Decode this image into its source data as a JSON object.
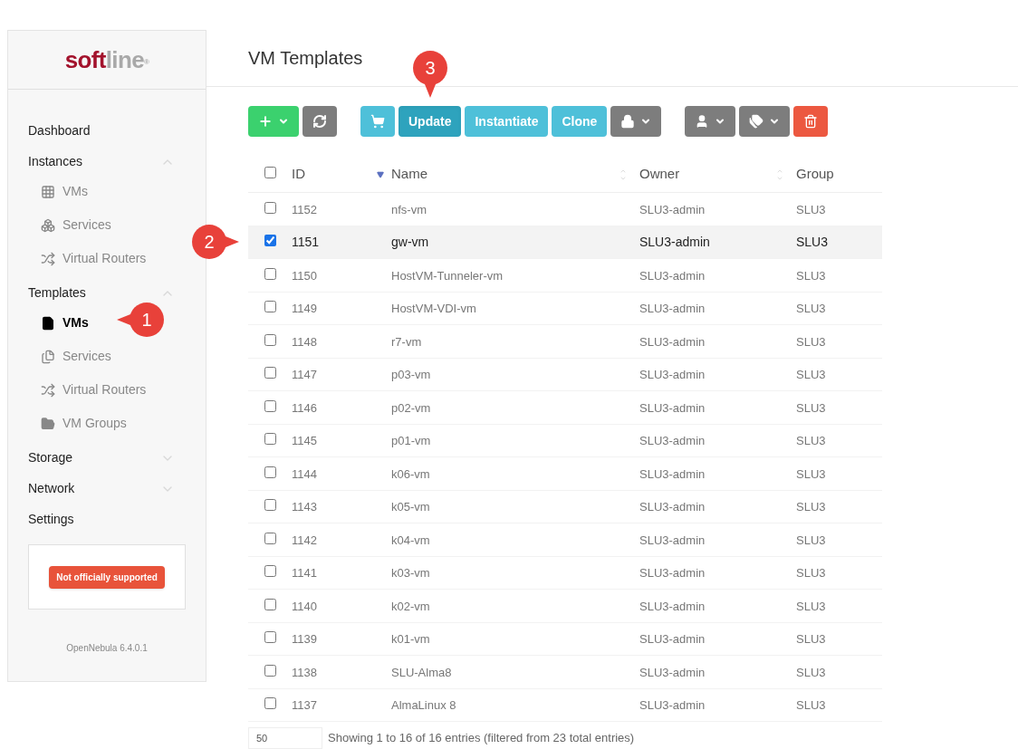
{
  "logo": {
    "part1": "soft",
    "part2": "line",
    "mark": "®"
  },
  "sidebar": {
    "items": [
      {
        "label": "Dashboard",
        "kind": "link"
      },
      {
        "label": "Instances",
        "kind": "group",
        "expanded": true,
        "children": [
          {
            "label": "VMs",
            "kind": "vms",
            "selected": false
          },
          {
            "label": "Services",
            "kind": "services",
            "selected": false
          },
          {
            "label": "Virtual Routers",
            "kind": "routers",
            "selected": false
          }
        ]
      },
      {
        "label": "Templates",
        "kind": "group",
        "expanded": true,
        "children": [
          {
            "label": "VMs",
            "kind": "templates",
            "selected": true
          },
          {
            "label": "Services",
            "kind": "service-templates",
            "selected": false
          },
          {
            "label": "Virtual Routers",
            "kind": "routers",
            "selected": false
          },
          {
            "label": "VM Groups",
            "kind": "groups",
            "selected": false
          }
        ]
      },
      {
        "label": "Storage",
        "kind": "group",
        "expanded": false
      },
      {
        "label": "Network",
        "kind": "group",
        "expanded": false
      },
      {
        "label": "Settings",
        "kind": "link"
      }
    ],
    "badge": "Not officially supported",
    "version": "OpenNebula 6.4.0.1"
  },
  "title": "VM Templates",
  "toolbar": [
    {
      "buttons": [
        {
          "kind": "create",
          "dropdown": true,
          "pressed": false
        },
        {
          "kind": "refresh",
          "dropdown": false,
          "pressed": false
        }
      ]
    },
    {
      "buttons": [
        {
          "kind": "cart",
          "dropdown": false,
          "pressed": false
        },
        {
          "kind": "text",
          "label": "Update",
          "dropdown": false,
          "pressed": true
        },
        {
          "kind": "text",
          "label": "Instantiate",
          "dropdown": false,
          "pressed": false
        },
        {
          "kind": "text",
          "label": "Clone",
          "dropdown": false,
          "pressed": false
        },
        {
          "kind": "lock",
          "dropdown": true,
          "pressed": false
        }
      ]
    },
    {
      "buttons": [
        {
          "kind": "user",
          "dropdown": true,
          "pressed": false
        },
        {
          "kind": "tags",
          "dropdown": true,
          "pressed": false
        },
        {
          "kind": "delete",
          "dropdown": false,
          "pressed": false
        }
      ]
    }
  ],
  "table": {
    "columns": [
      "ID",
      "Name",
      "Owner",
      "Group"
    ],
    "all_checked": false,
    "rows": [
      {
        "id": "1152",
        "name": "nfs-vm",
        "owner": "SLU3-admin",
        "group": "SLU3",
        "checked": false
      },
      {
        "id": "1151",
        "name": "gw-vm",
        "owner": "SLU3-admin",
        "group": "SLU3",
        "checked": true
      },
      {
        "id": "1150",
        "name": "HostVM-Tunneler-vm",
        "owner": "SLU3-admin",
        "group": "SLU3",
        "checked": false
      },
      {
        "id": "1149",
        "name": "HostVM-VDI-vm",
        "owner": "SLU3-admin",
        "group": "SLU3",
        "checked": false
      },
      {
        "id": "1148",
        "name": "r7-vm",
        "owner": "SLU3-admin",
        "group": "SLU3",
        "checked": false
      },
      {
        "id": "1147",
        "name": "p03-vm",
        "owner": "SLU3-admin",
        "group": "SLU3",
        "checked": false
      },
      {
        "id": "1146",
        "name": "p02-vm",
        "owner": "SLU3-admin",
        "group": "SLU3",
        "checked": false
      },
      {
        "id": "1145",
        "name": "p01-vm",
        "owner": "SLU3-admin",
        "group": "SLU3",
        "checked": false
      },
      {
        "id": "1144",
        "name": "k06-vm",
        "owner": "SLU3-admin",
        "group": "SLU3",
        "checked": false
      },
      {
        "id": "1143",
        "name": "k05-vm",
        "owner": "SLU3-admin",
        "group": "SLU3",
        "checked": false
      },
      {
        "id": "1142",
        "name": "k04-vm",
        "owner": "SLU3-admin",
        "group": "SLU3",
        "checked": false
      },
      {
        "id": "1141",
        "name": "k03-vm",
        "owner": "SLU3-admin",
        "group": "SLU3",
        "checked": false
      },
      {
        "id": "1140",
        "name": "k02-vm",
        "owner": "SLU3-admin",
        "group": "SLU3",
        "checked": false
      },
      {
        "id": "1139",
        "name": "k01-vm",
        "owner": "SLU3-admin",
        "group": "SLU3",
        "checked": false
      },
      {
        "id": "1138",
        "name": "SLU-Alma8",
        "owner": "SLU3-admin",
        "group": "SLU3",
        "checked": false
      },
      {
        "id": "1137",
        "name": "AlmaLinux 8",
        "owner": "SLU3-admin",
        "group": "SLU3",
        "checked": false
      }
    ]
  },
  "footer": {
    "page_length": "50",
    "info": "Showing 1 to 16 of 16 entries (filtered from 23 total entries)"
  },
  "callouts": [
    {
      "label": "1"
    },
    {
      "label": "2"
    },
    {
      "label": "3"
    }
  ]
}
